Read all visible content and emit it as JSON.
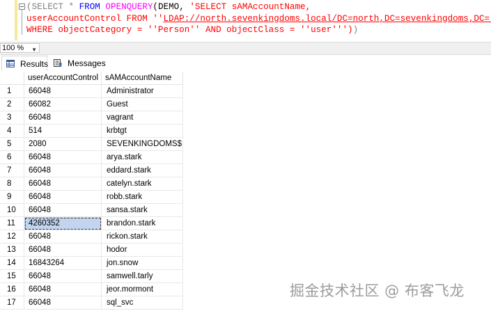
{
  "query": {
    "line1": [
      "(SELECT ",
      "* ",
      "FROM ",
      "OPENQUERY",
      "(DEMO, ",
      "'SELECT sAMAccountName,"
    ],
    "line2_str_a": "userAccountControl FROM ''",
    "line2_link": "LDAP://north.sevenkingdoms.local/DC=north,DC=sevenkingdoms,DC=local",
    "line2_str_b": "''",
    "line3_str": "WHERE objectCategory = ''Person'' AND objectClass = ''user''')",
    "line3_close": ")"
  },
  "zoom": {
    "value": "100 %"
  },
  "tabs": {
    "results": "Results",
    "messages": "Messages"
  },
  "grid": {
    "columns": [
      "userAccountControl",
      "sAMAccountName"
    ],
    "rows": [
      [
        "1",
        "66048",
        "Administrator"
      ],
      [
        "2",
        "66082",
        "Guest"
      ],
      [
        "3",
        "66048",
        "vagrant"
      ],
      [
        "4",
        "514",
        "krbtgt"
      ],
      [
        "5",
        "2080",
        "SEVENKINGDOMS$"
      ],
      [
        "6",
        "66048",
        "arya.stark"
      ],
      [
        "7",
        "66048",
        "eddard.stark"
      ],
      [
        "8",
        "66048",
        "catelyn.stark"
      ],
      [
        "9",
        "66048",
        "robb.stark"
      ],
      [
        "10",
        "66048",
        "sansa.stark"
      ],
      [
        "11",
        "4260352",
        "brandon.stark"
      ],
      [
        "12",
        "66048",
        "rickon.stark"
      ],
      [
        "13",
        "66048",
        "hodor"
      ],
      [
        "14",
        "16843264",
        "jon.snow"
      ],
      [
        "15",
        "66048",
        "samwell.tarly"
      ],
      [
        "16",
        "66048",
        "jeor.mormont"
      ],
      [
        "17",
        "66048",
        "sql_svc"
      ]
    ],
    "selected_row": 11
  },
  "watermark": "掘金技术社区 @ 布客飞龙",
  "colors": {
    "keyword": "#0000ff",
    "function": "#ff00ff",
    "string": "#ff0000",
    "selection": "#c2d4ee",
    "gutter": "#f5e79e"
  }
}
